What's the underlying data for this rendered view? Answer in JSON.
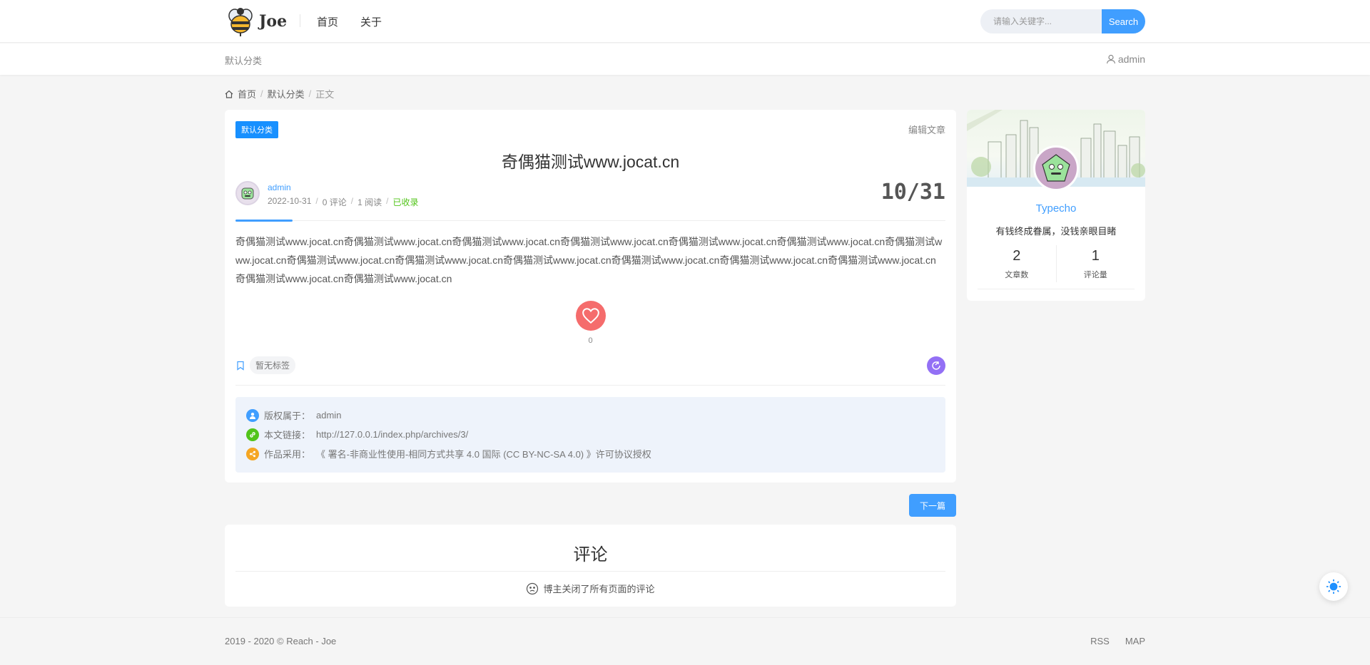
{
  "header": {
    "logo_text": "Joe",
    "nav": [
      {
        "label": "首页"
      },
      {
        "label": "关于"
      }
    ],
    "search": {
      "placeholder": "请输入关键字...",
      "button_label": "Search"
    }
  },
  "subheader": {
    "category": "默认分类",
    "user": "admin"
  },
  "breadcrumb": {
    "home": "首页",
    "separator": "/",
    "category": "默认分类",
    "current": "正文"
  },
  "article": {
    "category_tag": "默认分类",
    "edit_label": "编辑文章",
    "title": "奇偶猫测试www.jocat.cn",
    "author": "admin",
    "date": "2022-10-31",
    "comments": "0 评论",
    "reads": "1 阅读",
    "indexed": "已收录",
    "day_badge": "10/31",
    "content": "奇偶猫测试www.jocat.cn奇偶猫测试www.jocat.cn奇偶猫测试www.jocat.cn奇偶猫测试www.jocat.cn奇偶猫测试www.jocat.cn奇偶猫测试www.jocat.cn奇偶猫测试www.jocat.cn奇偶猫测试www.jocat.cn奇偶猫测试www.jocat.cn奇偶猫测试www.jocat.cn奇偶猫测试www.jocat.cn奇偶猫测试www.jocat.cn奇偶猫测试www.jocat.cn奇偶猫测试www.jocat.cn奇偶猫测试www.jocat.cn",
    "like_count": "0",
    "no_tags": "暂无标签",
    "copyright": {
      "owner_label": "版权属于：",
      "owner": "admin",
      "link_label": "本文链接：",
      "link": "http://127.0.0.1/index.php/archives/3/",
      "license_label": "作品采用：",
      "license": "《 署名-非商业性使用-相同方式共享 4.0 国际 (CC BY-NC-SA 4.0) 》许可协议授权"
    }
  },
  "next_label": "下一篇",
  "comments": {
    "title": "评论",
    "closed_text": "博主关闭了所有页面的评论"
  },
  "sidebar": {
    "name": "Typecho",
    "motto": "有钱终成眷属，没钱亲眼目睹",
    "stats": [
      {
        "value": "2",
        "label": "文章数"
      },
      {
        "value": "1",
        "label": "评论量"
      }
    ]
  },
  "footer": {
    "copyright": "2019 - 2020 © Reach - Joe",
    "links": [
      {
        "label": "RSS"
      },
      {
        "label": "MAP"
      }
    ]
  },
  "colors": {
    "accent": "#409eff",
    "like": "#f56c6c",
    "share": "#9370f5",
    "success": "#52c41a"
  }
}
